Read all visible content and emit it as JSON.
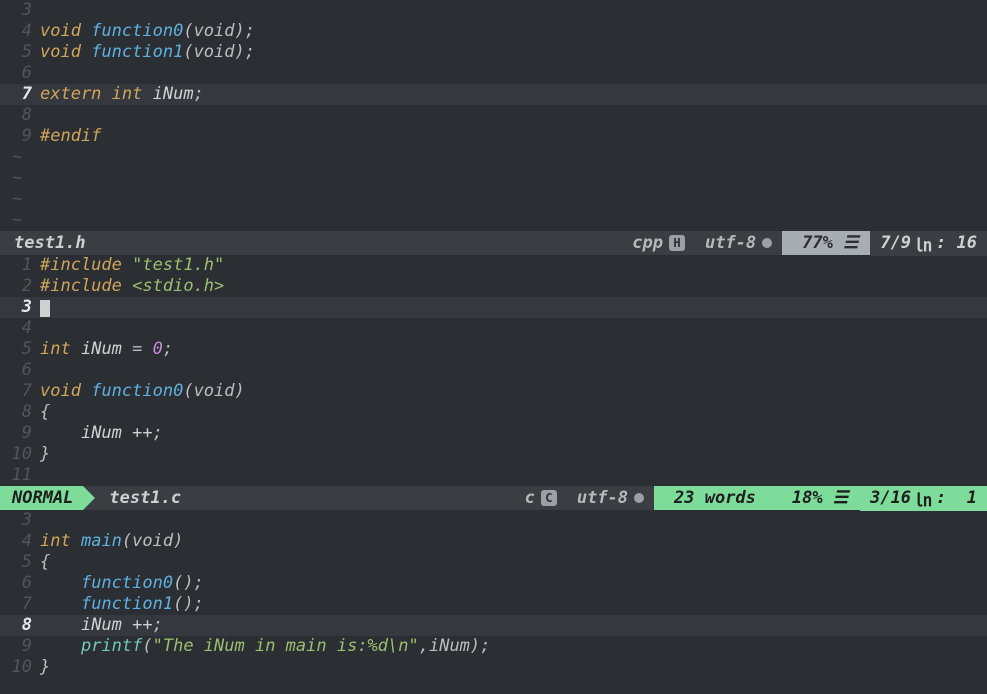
{
  "pane1": {
    "filename": "test1.h",
    "filetype": "cpp",
    "filetype_badge": "H",
    "encoding": "utf-8",
    "percent": "77% ☰",
    "position": "7/9",
    "col": ": 16",
    "cursor_line": "7",
    "lines": {
      "l3": {
        "num": "3",
        "txt": ""
      },
      "l4": {
        "num": "4",
        "kw1": "void",
        "fn": "function0",
        "rest": "(void);"
      },
      "l5": {
        "num": "5",
        "kw1": "void",
        "fn": "function1",
        "rest": "(void);"
      },
      "l6": {
        "num": "6",
        "txt": ""
      },
      "l7": {
        "num": "7",
        "kw1": "extern",
        "kw2": "int",
        "id": "iNum",
        "semi": ";"
      },
      "l8": {
        "num": "8",
        "txt": ""
      },
      "l9": {
        "num": "9",
        "pp": "#endif"
      }
    }
  },
  "pane2": {
    "mode": "NORMAL",
    "filename": "test1.c",
    "filetype": "c",
    "filetype_badge": "C",
    "encoding": "utf-8",
    "words": "23 words",
    "percent": "18% ☰",
    "position": "3/16",
    "col": ":  1",
    "cursor_line": "3",
    "lines": {
      "l1": {
        "num": "1",
        "pp": "#include",
        "str": "\"test1.h\""
      },
      "l2": {
        "num": "2",
        "pp": "#include",
        "str": "<stdio.h>"
      },
      "l3": {
        "num": "3"
      },
      "l4": {
        "num": "4",
        "txt": ""
      },
      "l5": {
        "num": "5",
        "kw": "int",
        "id": "iNum",
        "eq": " = ",
        "val": "0",
        "semi": ";"
      },
      "l6": {
        "num": "6",
        "txt": ""
      },
      "l7": {
        "num": "7",
        "kw": "void",
        "fn": "function0",
        "args": "(void)"
      },
      "l8": {
        "num": "8",
        "brace": "{"
      },
      "l9": {
        "num": "9",
        "indent": "    ",
        "id": "iNum ++",
        "semi": ";"
      },
      "l10": {
        "num": "10",
        "brace": "}"
      },
      "l11": {
        "num": "11",
        "txt": ""
      }
    }
  },
  "pane3": {
    "cursor_line": "8",
    "lines": {
      "l3": {
        "num": "3",
        "txt": ""
      },
      "l4": {
        "num": "4",
        "kw": "int",
        "fn": "main",
        "args": "(void)"
      },
      "l5": {
        "num": "5",
        "brace": "{"
      },
      "l6": {
        "num": "6",
        "indent": "    ",
        "fn": "function0",
        "rest": "();"
      },
      "l7": {
        "num": "7",
        "indent": "    ",
        "fn": "function1",
        "rest": "();"
      },
      "l8": {
        "num": "8",
        "indent": "    ",
        "id": "iNum ++",
        "semi": ";"
      },
      "l9": {
        "num": "9",
        "indent": "    ",
        "pf": "printf",
        "open": "(",
        "str": "\"The iNum in main is:%d\\n\"",
        "args": ",iNum);"
      },
      "l10": {
        "num": "10",
        "brace": "}"
      }
    }
  }
}
